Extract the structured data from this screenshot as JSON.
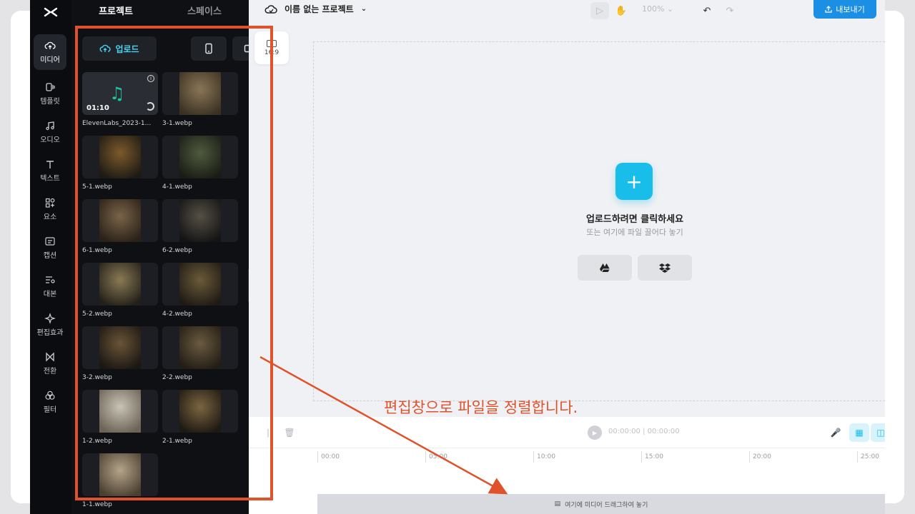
{
  "panel": {
    "tabs": [
      "프로젝트",
      "스페이스"
    ],
    "upload_label": "업로드",
    "tiles": [
      {
        "name": "ElevenLabs_2023-1...",
        "type": "audio",
        "duration": "01:10"
      },
      {
        "name": "3-1.webp",
        "type": "image",
        "colors": [
          "#8a7656",
          "#3c3224"
        ]
      },
      {
        "name": "5-1.webp",
        "type": "image",
        "colors": [
          "#7c5a2c",
          "#1e1a14"
        ]
      },
      {
        "name": "4-1.webp",
        "type": "image",
        "colors": [
          "#4f5a3e",
          "#1a1d15"
        ]
      },
      {
        "name": "6-1.webp",
        "type": "image",
        "colors": [
          "#7a6448",
          "#2a2118"
        ]
      },
      {
        "name": "6-2.webp",
        "type": "image",
        "colors": [
          "#555046",
          "#141414"
        ]
      },
      {
        "name": "5-2.webp",
        "type": "image",
        "colors": [
          "#8a7a55",
          "#222018"
        ]
      },
      {
        "name": "4-2.webp",
        "type": "image",
        "colors": [
          "#6b5a3a",
          "#1f1b14"
        ]
      },
      {
        "name": "3-2.webp",
        "type": "image",
        "colors": [
          "#6a5438",
          "#1b1712"
        ]
      },
      {
        "name": "2-2.webp",
        "type": "image",
        "colors": [
          "#6a5a40",
          "#221d15"
        ]
      },
      {
        "name": "1-2.webp",
        "type": "image",
        "colors": [
          "#c9c3b5",
          "#6a6356"
        ]
      },
      {
        "name": "2-1.webp",
        "type": "image",
        "colors": [
          "#7a6540",
          "#1e1912"
        ]
      },
      {
        "name": "1-1.webp",
        "type": "image",
        "colors": [
          "#b5a48a",
          "#4a3f30"
        ]
      }
    ]
  },
  "rail": {
    "items": [
      {
        "label": "미디어",
        "icon": "cloud-upload-icon",
        "active": true
      },
      {
        "label": "템플릿",
        "icon": "template-icon",
        "active": false
      },
      {
        "label": "오디오",
        "icon": "music-icon",
        "active": false
      },
      {
        "label": "텍스트",
        "icon": "text-icon",
        "active": false
      },
      {
        "label": "요소",
        "icon": "shapes-icon",
        "active": false
      },
      {
        "label": "캡션",
        "icon": "caption-icon",
        "active": false
      },
      {
        "label": "대본",
        "icon": "script-icon",
        "active": false
      },
      {
        "label": "편집효과",
        "icon": "sparkle-icon",
        "active": false
      },
      {
        "label": "전환",
        "icon": "transition-icon",
        "active": false
      },
      {
        "label": "필터",
        "icon": "filter-icon",
        "active": false
      }
    ]
  },
  "topbar": {
    "project_name": "이름 없는 프로젝트",
    "zoom": "100%",
    "export_label": "내보내기"
  },
  "canvas": {
    "ratio_label": "16:9",
    "upload_title": "업로드하려면 클릭하세요",
    "upload_subtitle": "또는 여기에 파일 끌어다 놓기"
  },
  "timeline": {
    "current_time": "00:00:00",
    "total_time": "00:00:00",
    "ticks": [
      "00:00",
      "05:00",
      "10:00",
      "15:00",
      "20:00",
      "25:00"
    ],
    "track_hint": "여기에 미디어 드래그하여 놓기"
  },
  "annotation": {
    "text": "편집창으로 파일을 정렬합니다.",
    "color": "#e0522a"
  }
}
